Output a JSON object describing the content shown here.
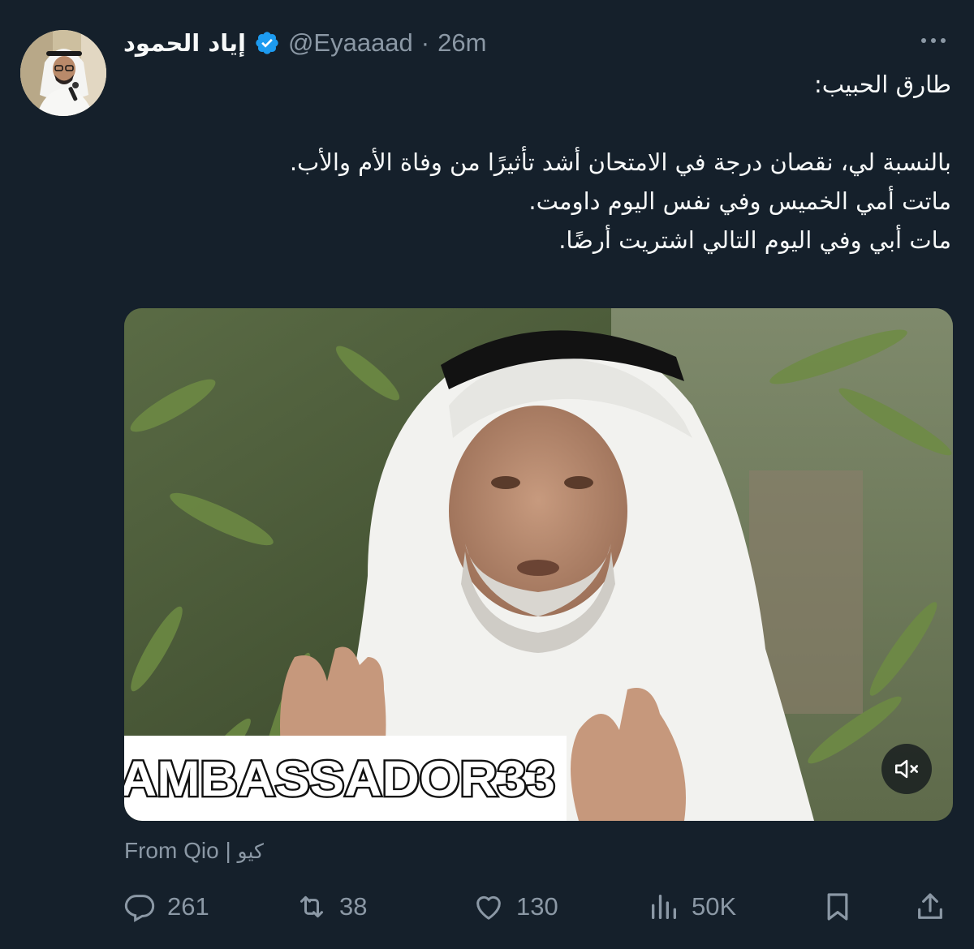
{
  "tweet": {
    "author": {
      "display_name": "إياد الحمود",
      "handle": "@Eyaaaad",
      "separator": "·",
      "time": "26m",
      "verified": true,
      "verified_color": "#1d9bf0"
    },
    "text_lines": [
      "طارق الحبيب:",
      "",
      "بالنسبة لي، نقصان درجة في الامتحان أشد تأثيرًا من وفاة الأم والأب.",
      "ماتت أمي الخميس وفي نفس اليوم داومت.",
      "مات أبي وفي اليوم التالي اشتريت أرضًا."
    ],
    "media": {
      "watermark_text": "AMBASSADOR33",
      "mute_icon": "speaker-muted-icon"
    },
    "source": {
      "prefix": "From Qio",
      "separator": "|",
      "arabic_name": "كيو"
    },
    "actions": {
      "replies": "261",
      "retweets": "38",
      "likes": "130",
      "views": "50K"
    },
    "icons": {
      "reply": "reply-icon",
      "retweet": "retweet-icon",
      "like": "heart-icon",
      "views": "views-icon",
      "bookmark": "bookmark-icon",
      "share": "share-icon",
      "more": "more-icon"
    },
    "colors": {
      "background": "#15202b",
      "primary_text": "#f7f9f9",
      "secondary_text": "#8b98a5",
      "accent": "#1d9bf0"
    }
  }
}
